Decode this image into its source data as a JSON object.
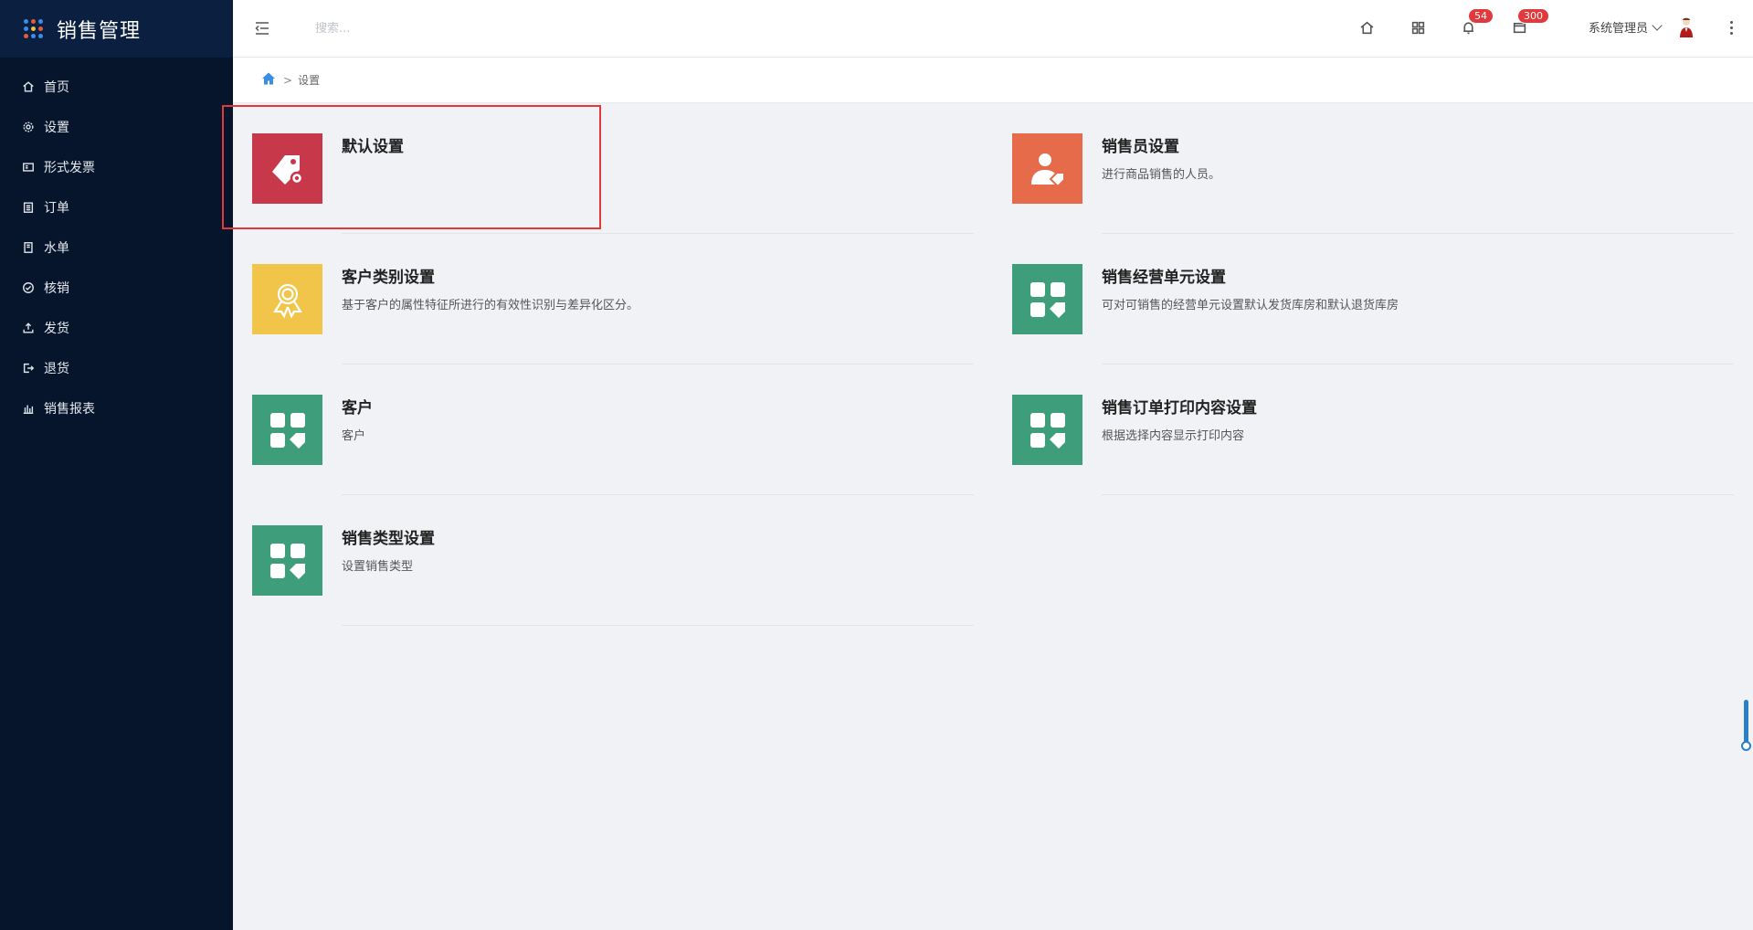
{
  "app": {
    "title": "销售管理"
  },
  "sidebar": {
    "items": [
      {
        "label": "首页",
        "icon": "home-icon"
      },
      {
        "label": "设置",
        "icon": "gear-icon"
      },
      {
        "label": "形式发票",
        "icon": "invoice-icon"
      },
      {
        "label": "订单",
        "icon": "clipboard-icon"
      },
      {
        "label": "水单",
        "icon": "receipt-icon"
      },
      {
        "label": "核销",
        "icon": "check-circle-icon"
      },
      {
        "label": "发货",
        "icon": "upload-icon"
      },
      {
        "label": "退货",
        "icon": "logout-icon"
      },
      {
        "label": "销售报表",
        "icon": "bar-chart-icon"
      }
    ]
  },
  "header": {
    "search_placeholder": "搜索...",
    "notifications_count": "54",
    "messages_count": "300",
    "user_name": "系统管理员"
  },
  "breadcrumb": {
    "current": "设置",
    "separator": ">"
  },
  "settings_cards": [
    {
      "title": "默认设置",
      "desc": "",
      "icon": "price-tag-gear-icon",
      "color": "#c7394a"
    },
    {
      "title": "销售员设置",
      "desc": "进行商品销售的人员。",
      "icon": "salesperson-icon",
      "color": "#e56b4b"
    },
    {
      "title": "客户类别设置",
      "desc": "基于客户的属性特征所进行的有效性识别与差异化区分。",
      "icon": "award-ribbon-icon",
      "color": "#f1c44a"
    },
    {
      "title": "销售经营单元设置",
      "desc": "可对可销售的经营单元设置默认发货库房和默认退货库房",
      "icon": "apps-tag-icon",
      "color": "#3e9e7c"
    },
    {
      "title": "客户",
      "desc": "客户",
      "icon": "apps-tag-icon",
      "color": "#3e9e7c"
    },
    {
      "title": "销售订单打印内容设置",
      "desc": "根据选择内容显示打印内容",
      "icon": "apps-tag-icon",
      "color": "#3e9e7c"
    },
    {
      "title": "销售类型设置",
      "desc": "设置销售类型",
      "icon": "apps-tag-icon",
      "color": "#3e9e7c"
    }
  ]
}
